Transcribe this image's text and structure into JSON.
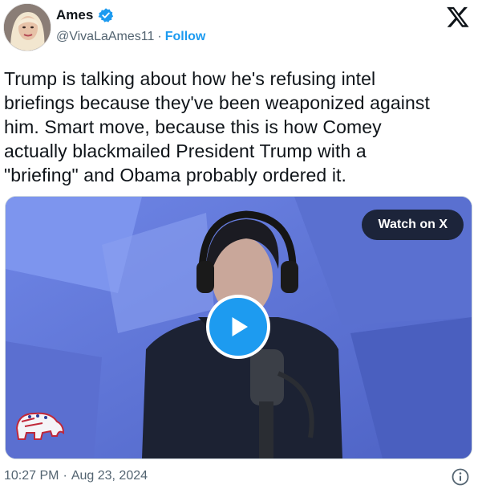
{
  "author": {
    "display_name": "Ames",
    "handle": "@VivaLaAmes11",
    "separator": "·",
    "follow_label": "Follow",
    "verified_icon": "verified-badge-icon",
    "verified_color": "#1d9bf0"
  },
  "platform_icon": "x-logo-icon",
  "tweet": {
    "text": "Trump is talking about how he's refusing intel\nbriefings because they've been weaponized against\nhim. Smart move, because this is how Comey\nactually blackmailed President Trump with a\n\"briefing\" and Obama probably ordered it."
  },
  "media": {
    "watch_label": "Watch on X",
    "play_icon": "play-icon",
    "accent": "#1d9bf0"
  },
  "footer": {
    "time": "10:27 PM",
    "separator": "·",
    "date": "Aug 23, 2024",
    "info_icon": "info-icon"
  },
  "colors": {
    "text": "#0f1419",
    "muted": "#536471",
    "link": "#1d9bf0"
  }
}
